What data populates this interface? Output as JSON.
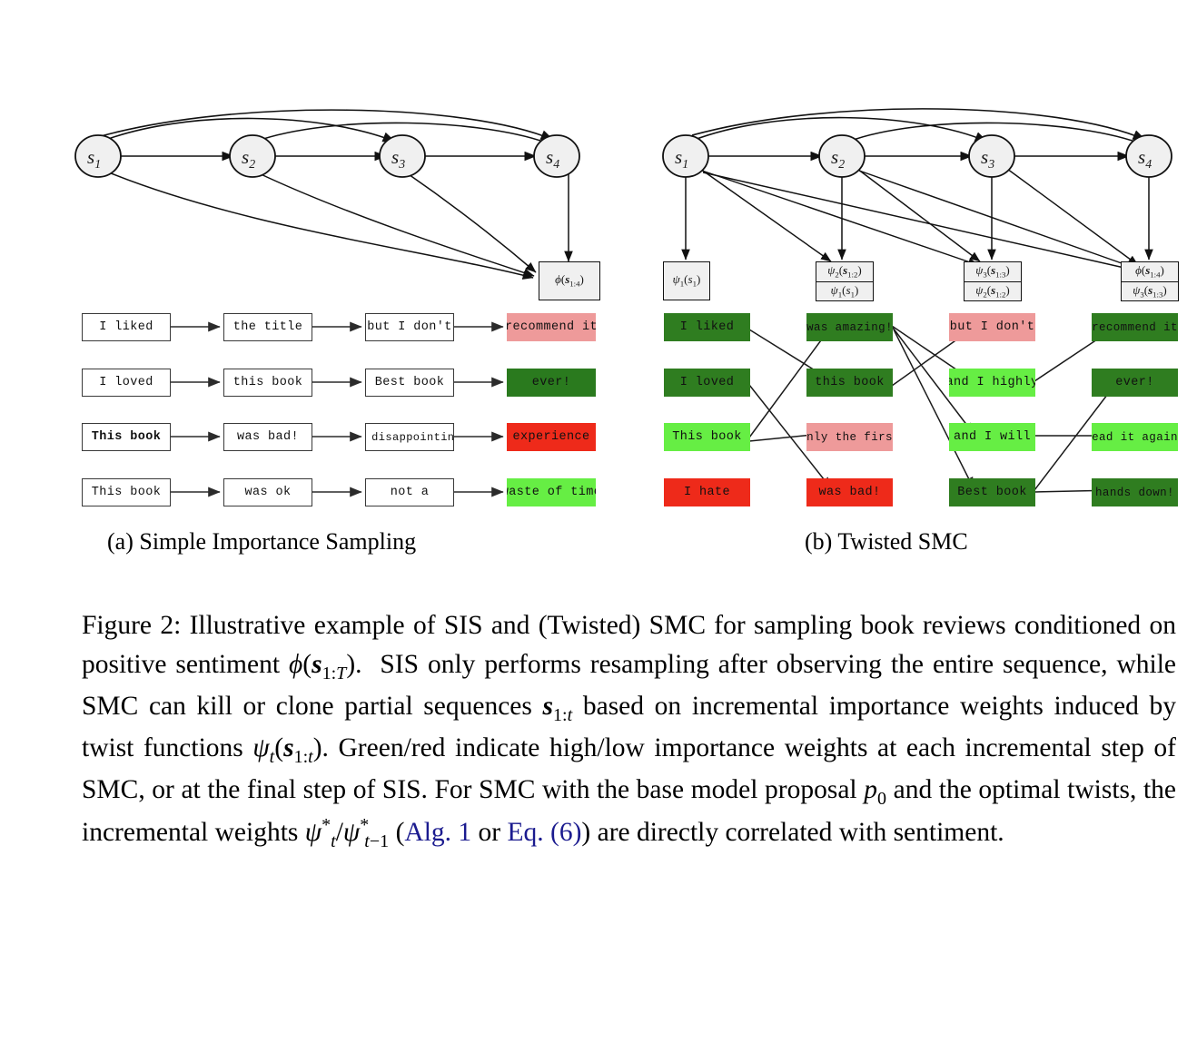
{
  "figure": {
    "number": "Figure 2",
    "subcaption_a": "(a) Simple Importance Sampling",
    "subcaption_b": "(b) Twisted SMC",
    "caption_segments": {
      "s1": "Figure 2: Illustrative example of SIS and (Twisted) SMC for sampling book reviews conditioned on positive sentiment ",
      "phi_sT": "ϕ(s1:T)",
      "s2": ". SIS only performs resampling after observing the entire sequence, while SMC can kill or clone partial sequences ",
      "s_1t": "s1:t",
      "s3": " based on incremental importance weights induced by twist functions ",
      "psi_t": "ψt(s1:t)",
      "s4": ". Green/red indicate high/low importance weights at each incremental step of SMC, or at the final step of SIS. For SMC with the base model proposal ",
      "p0": "p0",
      "s5": " and the, optimal twists, the incremental weights ",
      "psi_ratio": "ψ*t/ψ*t−1",
      "s6": " (",
      "link1": "Alg. 1",
      "s7": " or ",
      "link2": "Eq. (6)",
      "s8": ") are directly correlated with sentiment.",
      "link_color": "#1b1b8f"
    }
  },
  "graph": {
    "node_labels": [
      "s",
      "s",
      "s",
      "s"
    ],
    "node_subscripts": [
      "1",
      "2",
      "3",
      "4"
    ],
    "node_fill": "#f0f0f0",
    "node_stroke": "#111111",
    "edge_color": "#111111"
  },
  "panel_a": {
    "potential_box": {
      "single": "ϕ(s1:4)",
      "num": "",
      "den": ""
    },
    "rows": [
      {
        "tokens": [
          {
            "text": "I liked",
            "style": "plain",
            "bold": false
          },
          {
            "text": "the title",
            "style": "plain",
            "bold": false
          },
          {
            "text": "but I don't",
            "style": "plain",
            "bold": false
          },
          {
            "text": "recommend it",
            "style": "filled",
            "bold": false,
            "color": "#ee9a9a"
          }
        ]
      },
      {
        "tokens": [
          {
            "text": "I loved",
            "style": "plain",
            "bold": false
          },
          {
            "text": "this book",
            "style": "plain",
            "bold": false
          },
          {
            "text": "Best book",
            "style": "plain",
            "bold": false
          },
          {
            "text": "ever!",
            "style": "filled",
            "bold": false,
            "color": "#2a7a1e"
          }
        ]
      },
      {
        "tokens": [
          {
            "text": "This book",
            "style": "plain",
            "bold": true
          },
          {
            "text": "was bad!",
            "style": "plain",
            "bold": false
          },
          {
            "text": "A disappointing",
            "style": "plain",
            "bold": false
          },
          {
            "text": "experience",
            "style": "filled",
            "bold": false,
            "color": "#ee2a1a"
          }
        ]
      },
      {
        "tokens": [
          {
            "text": "This book",
            "style": "plain",
            "bold": false
          },
          {
            "text": "was ok",
            "style": "plain",
            "bold": false
          },
          {
            "text": "not a",
            "style": "plain",
            "bold": false
          },
          {
            "text": "waste of time",
            "style": "filled",
            "bold": false,
            "color": "#66ee44"
          }
        ]
      }
    ]
  },
  "panel_b": {
    "twist_boxes": [
      {
        "single": "ψ1(s1)",
        "num": "",
        "den": ""
      },
      {
        "single": "",
        "num": "ψ2(s1:2)",
        "den": "ψ1(s1)"
      },
      {
        "single": "",
        "num": "ψ3(s1:3)",
        "den": "ψ2(s1:2)"
      },
      {
        "single": "",
        "num": "ϕ(s1:4)",
        "den": "ψ3(s1:3)"
      }
    ],
    "columns": [
      [
        {
          "text": "I liked",
          "color": "#2f7d20"
        },
        {
          "text": "I loved",
          "color": "#2f7d20"
        },
        {
          "text": "This book",
          "color": "#66ee44"
        },
        {
          "text": "I hate",
          "color": "#ee2a1a"
        }
      ],
      [
        {
          "text": "was amazing!",
          "color": "#2f7d20"
        },
        {
          "text": "this book",
          "color": "#2f7d20"
        },
        {
          "text": "only the first",
          "color": "#ee9a9a"
        },
        {
          "text": "was bad!",
          "color": "#ee2a1a"
        }
      ],
      [
        {
          "text": "but I don't",
          "color": "#ee9a9a"
        },
        {
          "text": "and I highly",
          "color": "#66ee44"
        },
        {
          "text": "and I will",
          "color": "#66ee44"
        },
        {
          "text": "Best book",
          "color": "#2f7d20"
        }
      ],
      [
        {
          "text": "recommend it",
          "color": "#2f7d20"
        },
        {
          "text": "ever!",
          "color": "#2f7d20"
        },
        {
          "text": "read it again!",
          "color": "#66ee44"
        },
        {
          "text": "hands down!",
          "color": "#2f7d20"
        }
      ]
    ]
  }
}
